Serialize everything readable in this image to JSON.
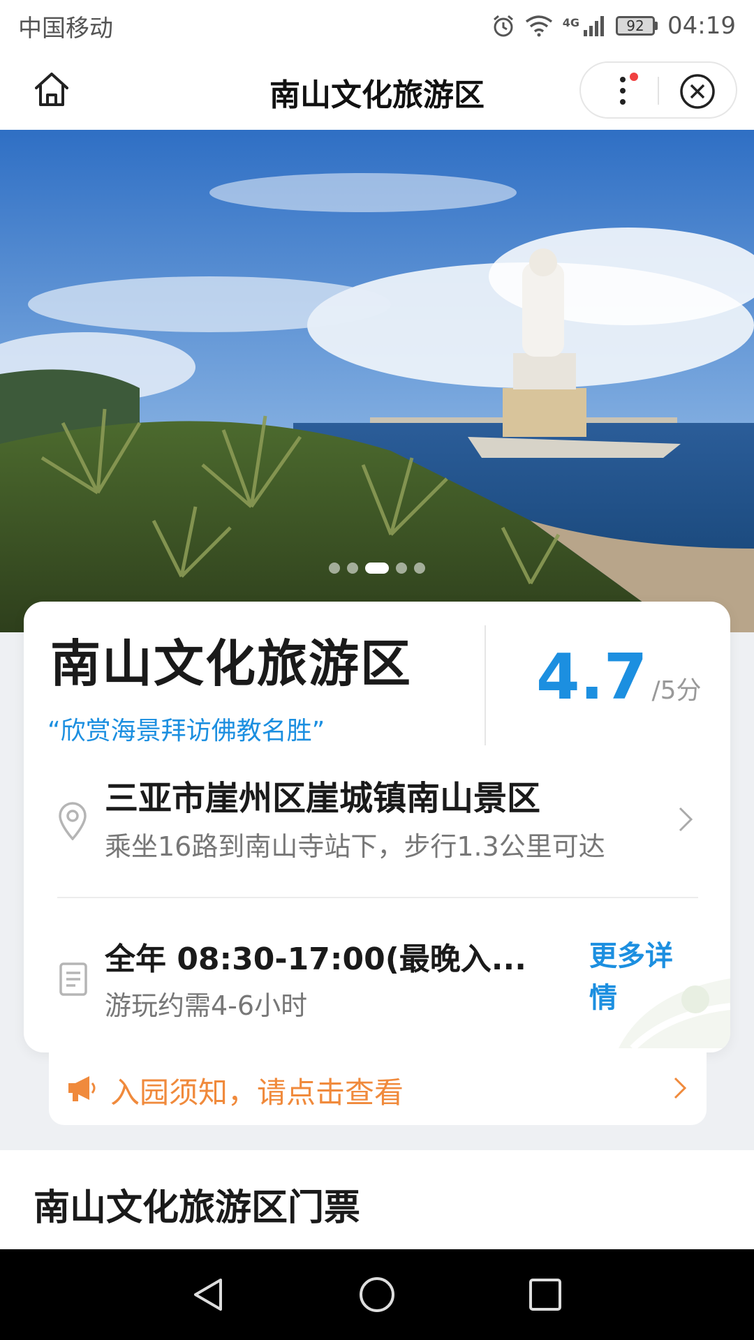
{
  "status_bar": {
    "carrier": "中国移动",
    "network": "4G",
    "battery": "92",
    "time": "04:19"
  },
  "nav": {
    "title": "南山文化旅游区",
    "icons": [
      "home-icon",
      "more-dots-icon",
      "close-circle-icon"
    ]
  },
  "hero": {
    "slide_count": 5,
    "active_slide": 3
  },
  "info": {
    "name": "南山文化旅游区",
    "slogan": "“欣赏海景拜访佛教名胜”",
    "rating": "4.7",
    "rating_max": "/5分",
    "address_title": "三亚市崖州区崖城镇南山景区",
    "address_sub": "乘坐16路到南山寺站下，步行1.3公里可达",
    "hours_title": "全年 08:30-17:00(最晚入...",
    "hours_sub": "游玩约需4-6小时",
    "more_detail": "更多详情"
  },
  "notice": {
    "text": "入园须知，请点击查看"
  },
  "tickets": {
    "title": "南山文化旅游区门票"
  },
  "colors": {
    "accent": "#1c8fe0",
    "notice": "#f08a3c"
  }
}
